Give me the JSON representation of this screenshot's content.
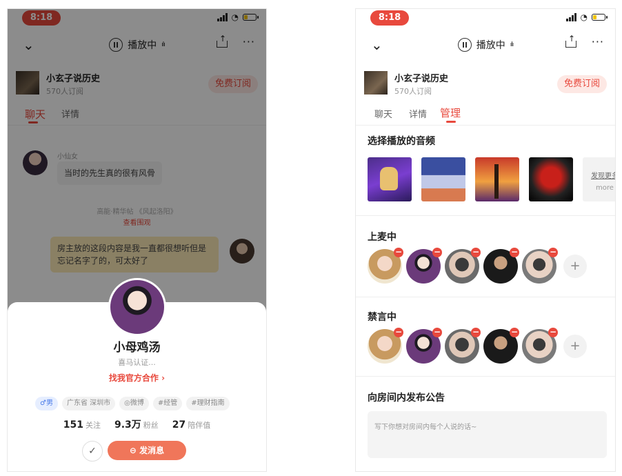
{
  "status_bar": {
    "time": "8:18"
  },
  "nav": {
    "playing_label": "播放中",
    "wave_glyph": "ılı"
  },
  "podcast": {
    "name": "小玄子说历史",
    "subscribers": "570人订阅",
    "subscribe_label": "免费订阅"
  },
  "left": {
    "tabs": [
      "聊天",
      "详情"
    ],
    "chat": {
      "sender_name": "小仙女",
      "message_1": "当时的先生真的很有风骨",
      "system_notice": "高能·精华帖 《风起洛阳》",
      "system_link": "查看围观",
      "message_mine": "房主放的这段内容是我一直都很想听但是忘记名字了的，可太好了"
    },
    "profile": {
      "name": "小母鸡汤",
      "verified": "喜马认证...",
      "cooperate_link": "找我官方合作",
      "cooperate_arrow": "›",
      "tags": [
        {
          "label": "♂男",
          "style": "blue"
        },
        {
          "label": "广东省 深圳市",
          "style": "gray"
        },
        {
          "label": "◎微博",
          "style": "gray"
        },
        {
          "label": "#经管",
          "style": "gray"
        },
        {
          "label": "#理财指南",
          "style": "gray"
        }
      ],
      "stats": [
        {
          "value": "151",
          "label": "关注"
        },
        {
          "value": "9.3万",
          "label": "粉丝"
        },
        {
          "value": "27",
          "label": "陪伴值"
        }
      ],
      "check_glyph": "✓",
      "message_button": "⊖ 发消息"
    }
  },
  "right": {
    "tabs": [
      "聊天",
      "详情",
      "管理"
    ],
    "active_tab": "管理",
    "audio_section": {
      "title": "选择播放的音频",
      "discover_label": "发现更多",
      "more_label": "more"
    },
    "on_mic": {
      "title": "上麦中"
    },
    "muted": {
      "title": "禁言中"
    },
    "notice": {
      "title": "向房间内发布公告",
      "placeholder": "写下你想对房间内每个人说的话~"
    },
    "remove_glyph": "−",
    "add_glyph": "+"
  },
  "colors": {
    "accent": "#e8493d",
    "message_button": "#f0765a",
    "bubble_mine": "#fbe9b6"
  }
}
